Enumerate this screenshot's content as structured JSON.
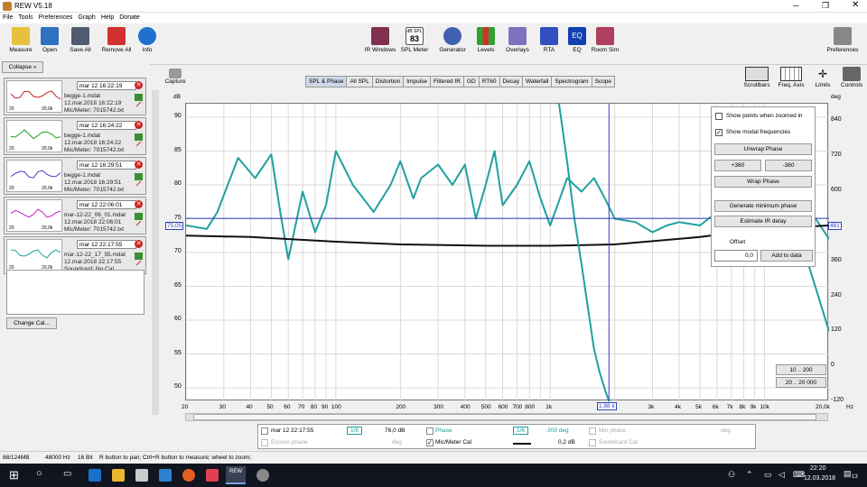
{
  "app": {
    "title": "REW V5.18"
  },
  "menu": [
    "File",
    "Tools",
    "Preferences",
    "Graph",
    "Help",
    "Donate"
  ],
  "toolbar_left": [
    "Measure",
    "Open",
    "Save All",
    "Remove All",
    "Info"
  ],
  "toolbar_center": [
    "IR Windows",
    "SPL Meter",
    "Generator",
    "Levels",
    "Overlays",
    "RTA",
    "EQ",
    "Room Sim"
  ],
  "spl_badge": {
    "top": "dB SPL",
    "value": "83"
  },
  "preferences_label": "Preferences",
  "collapse_label": "Collapse",
  "measurements": [
    {
      "name": "mar 12 16:22:19",
      "file": "begge-1.mdat",
      "date": "12.mar.2018 16:22:19",
      "cal": "Mic/Meter: 7015742.txt",
      "color": "#c02020"
    },
    {
      "name": "mar 12 16:24:22",
      "file": "begge-1.mdat",
      "date": "12.mar.2018 16:24:22",
      "cal": "Mic/Meter: 7015742.txt",
      "color": "#20a020"
    },
    {
      "name": "mar 12 16:29:51",
      "file": "begge-1.mdat",
      "date": "12.mar.2018 16:29:51",
      "cal": "Mic/Meter: 7015742.txt",
      "color": "#4040c0"
    },
    {
      "name": "mar 12 22:06:01",
      "file": "mar-12-22_06_01.mdat",
      "date": "12.mar.2018 22:06:01",
      "cal": "Mic/Meter: 7015742.txt",
      "color": "#c020c0"
    },
    {
      "name": "mar 12 22:17:55",
      "file": "mar-12-22_17_55.mdat",
      "date": "12.mar.2018 22:17:55",
      "cal": "Soundcard: No Cal",
      "color": "#20a0a0"
    }
  ],
  "thumb_axis": {
    "low": "20",
    "high": "20,0k"
  },
  "change_cal_label": "Change Cal...",
  "capture": {
    "label": "Capture",
    "unit": "dB"
  },
  "tabs": [
    "SPL & Phase",
    "All SPL",
    "Distortion",
    "Impulse",
    "Filtered IR",
    "GD",
    "RT60",
    "Decay",
    "Waterfall",
    "Spectrogram",
    "Scope"
  ],
  "right_tools": [
    "Scrollbars",
    "Freq. Axis",
    "Limits",
    "Controls"
  ],
  "right_unit": "deg",
  "y_left": [
    "90",
    "85",
    "80",
    "75",
    "70",
    "65",
    "60",
    "55",
    "50"
  ],
  "y_right": [
    "840",
    "720",
    "600",
    "480",
    "360",
    "240",
    "120",
    "0",
    "-120"
  ],
  "cursor": {
    "y_left": "75,05",
    "y_right": "481",
    "x": "1,88 k"
  },
  "x_ticks": [
    "20",
    "30",
    "40",
    "50",
    "60",
    "70",
    "80",
    "90",
    "100",
    "200",
    "300",
    "400",
    "500",
    "600",
    "700",
    "800",
    "1k",
    "2k",
    "3k",
    "4k",
    "5k",
    "6k",
    "7k",
    "8k",
    "9k",
    "10k",
    "20,0k",
    "Hz"
  ],
  "controls": {
    "show_points": "Show points when zoomed in",
    "show_modal": "Show modal frequencies",
    "unwrap": "Unwrap Phase",
    "plus360": "+360",
    "minus360": "-360",
    "wrap": "Wrap Phase",
    "gen_min": "Generate minimum phase",
    "estimate": "Estimate IR delay",
    "offset_label": "Offset",
    "offset_value": "0,0",
    "add_label": "Add to data"
  },
  "range_buttons": [
    "10 .. 200",
    "20 .. 20 000"
  ],
  "legend": {
    "r1": {
      "name": "mar 12 22:17:55",
      "smooth": "1/6",
      "val": "76,0 dB",
      "phase": "Phase",
      "phase_smooth": "1/6",
      "phase_val": "-309 deg",
      "minphase": "Min phase",
      "minphase_unit": "deg"
    },
    "r2": {
      "excess": "Excess phase",
      "excess_unit": "deg",
      "mic": "Mic/Meter Cal",
      "mic_val": "0,2 dB",
      "sc": "Soundcard Cal"
    }
  },
  "status": {
    "mem": "88/124MB",
    "rate": "48000 Hz",
    "bits": "16 Bit",
    "hint": "R button to pan; Ctrl+R button to measure; wheel to zoom;"
  },
  "taskbar": {
    "time": "22:20",
    "date": "12.03.2018",
    "app": "REW",
    "badge": "13"
  },
  "chart_data": {
    "type": "line",
    "xscale": "log",
    "xlim": [
      20,
      20000
    ],
    "ylim": [
      48,
      92
    ],
    "y2lim": [
      -120,
      900
    ],
    "series": [
      {
        "color": "#20a0a0",
        "axis": "left",
        "x": [
          20,
          25,
          28,
          35,
          42,
          50,
          55,
          60,
          70,
          80,
          90,
          100,
          120,
          150,
          180,
          200,
          230,
          250,
          300,
          350,
          400,
          450,
          500,
          550,
          600,
          700,
          800,
          900,
          1000,
          1200,
          1400,
          1600,
          1800,
          2000,
          2500,
          3000,
          3500,
          4000,
          5000,
          6000,
          7000,
          8000,
          9000,
          10000,
          12000,
          15000,
          20000
        ],
        "y": [
          74,
          73.5,
          76,
          84,
          81,
          84.5,
          76,
          69,
          79,
          73,
          77,
          85,
          80,
          76,
          80,
          83.5,
          78,
          81,
          83,
          80,
          83,
          75,
          80,
          85,
          77,
          80,
          83.5,
          78,
          74,
          81,
          79,
          81,
          78,
          75,
          74.5,
          73,
          74,
          74.5,
          74,
          76,
          77,
          75,
          74,
          76,
          80,
          78,
          72
        ]
      },
      {
        "color": "#101010",
        "axis": "left",
        "x": [
          20,
          40,
          100,
          200,
          500,
          1000,
          2000,
          5000,
          10000,
          20000
        ],
        "y": [
          72.5,
          72.3,
          71.6,
          71.2,
          71,
          71,
          71.2,
          72.3,
          73.5,
          74
        ]
      },
      {
        "color": "#20a0a0",
        "axis": "right",
        "x": [
          1100,
          1200,
          1300,
          1400,
          1500,
          1600,
          1700,
          1800,
          1880
        ],
        "y": [
          900,
          700,
          500,
          350,
          200,
          60,
          -20,
          -80,
          -120
        ]
      },
      {
        "color": "#20a0a0",
        "axis": "right",
        "x": [
          10000,
          12000,
          14000,
          16000,
          18000,
          20000
        ],
        "y": [
          500,
          600,
          480,
          350,
          230,
          120
        ]
      }
    ]
  }
}
